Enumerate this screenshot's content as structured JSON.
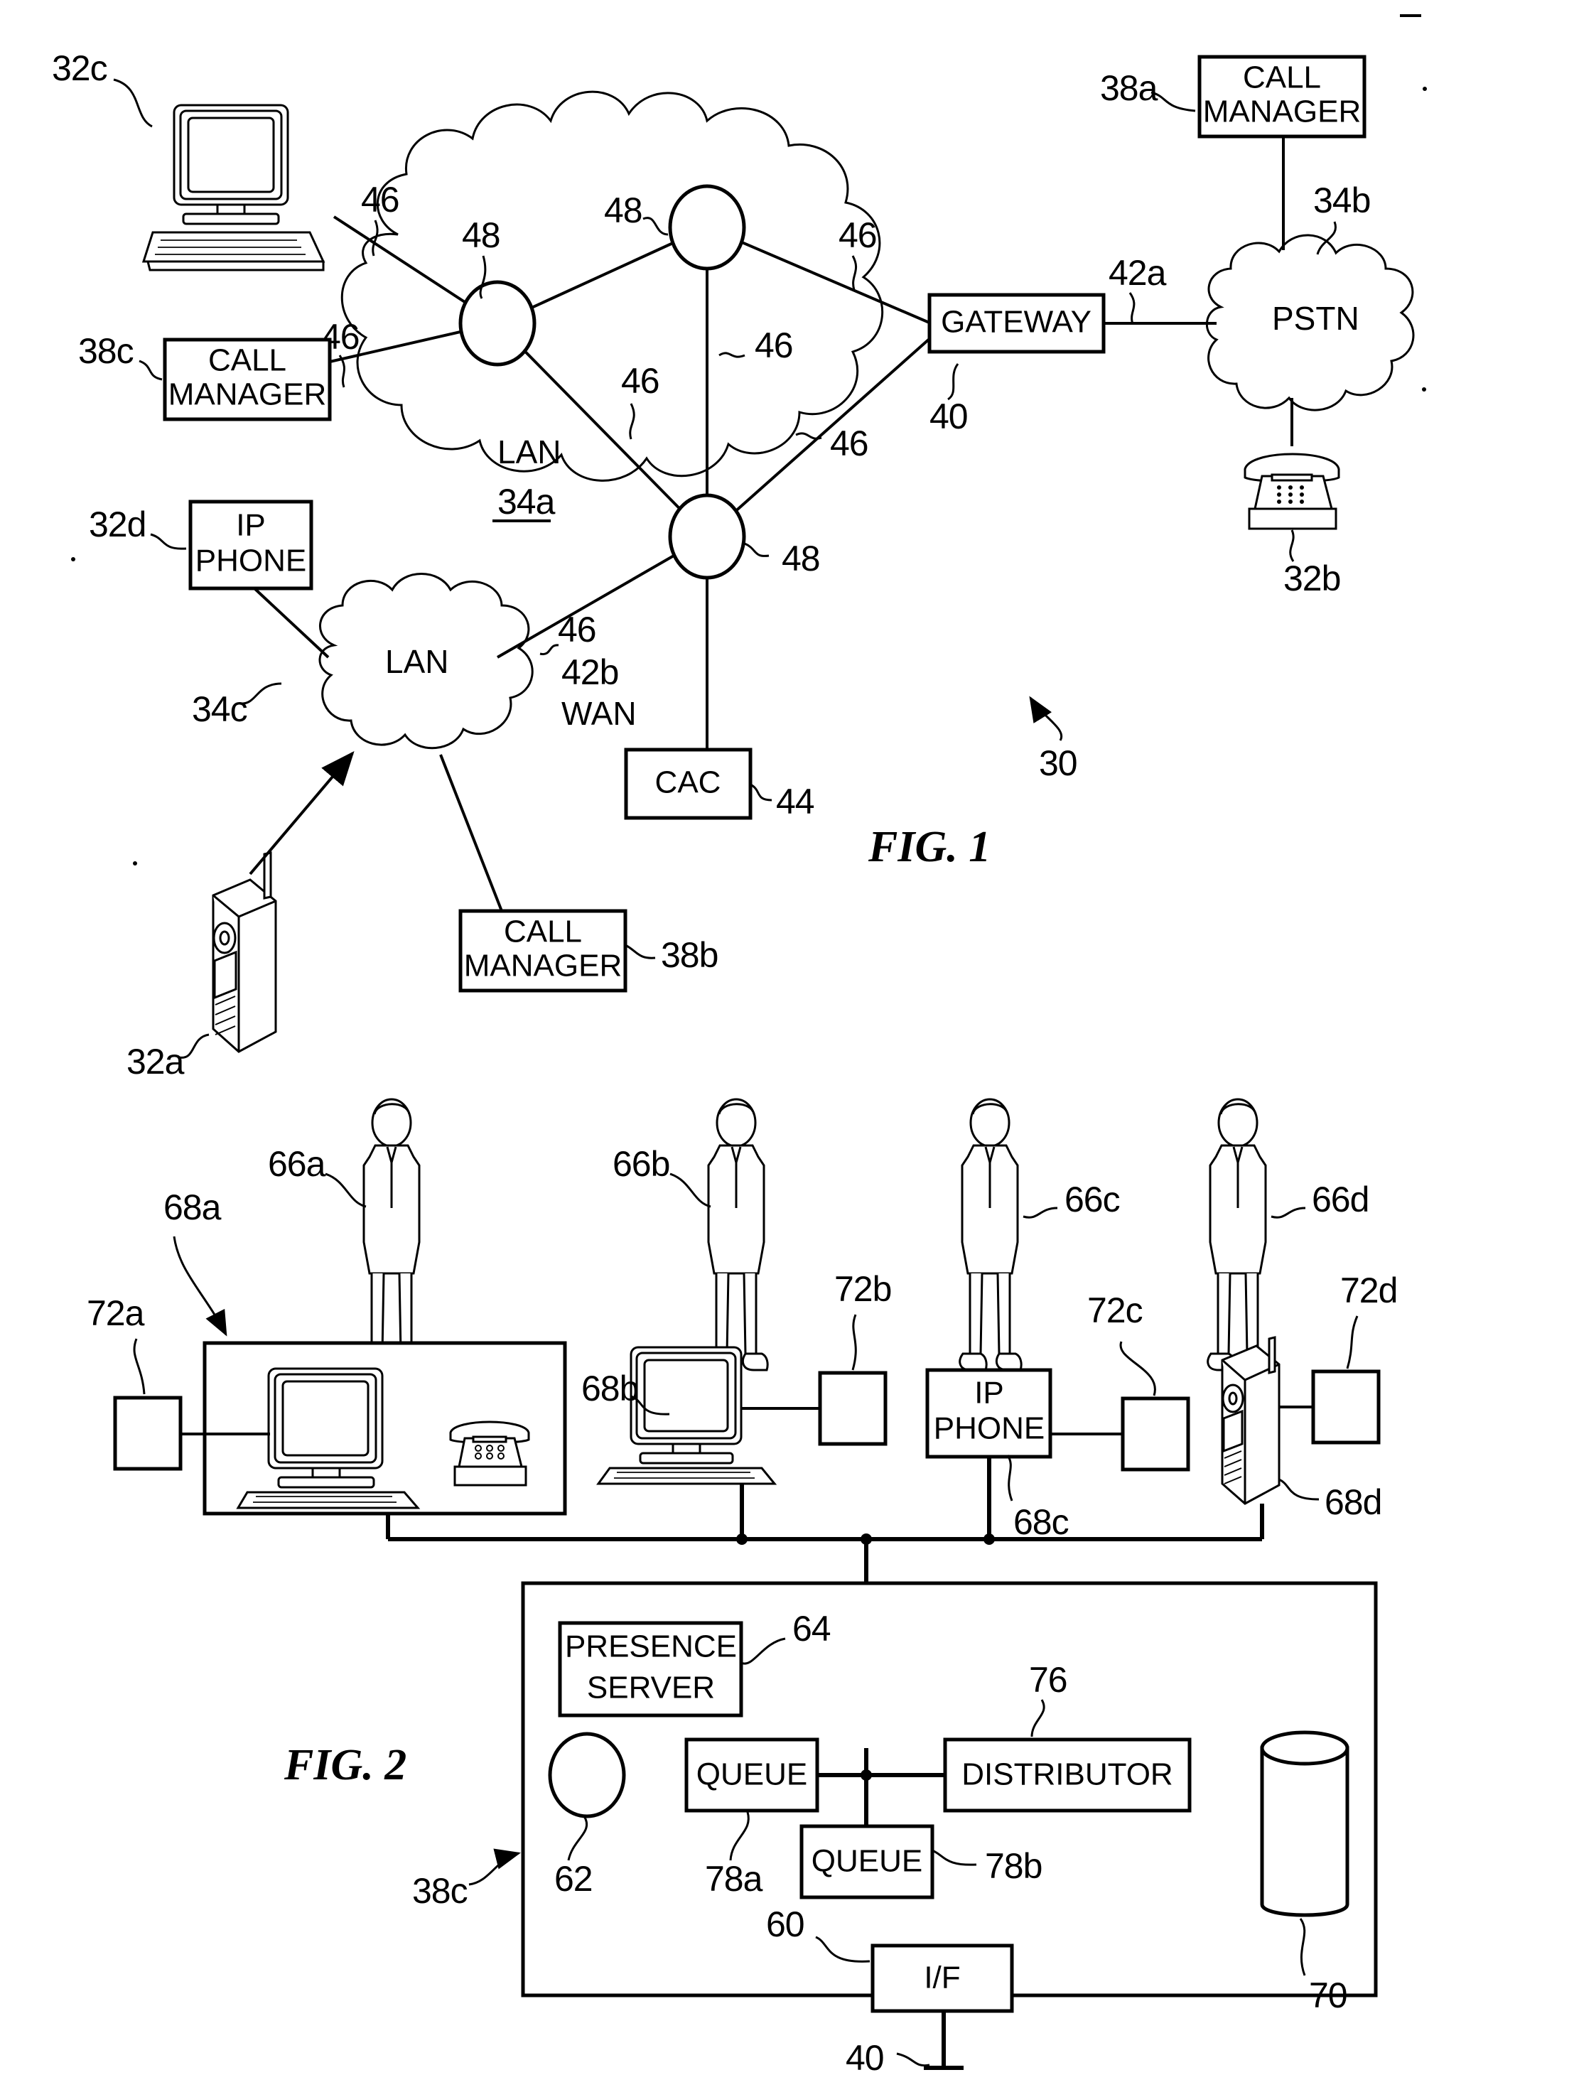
{
  "figures": [
    {
      "id": "fig1",
      "caption": "FIG. 1",
      "system_ref": "30",
      "nodes": {
        "computer_32c_ref": "32c",
        "call_manager_38c_label": "CALL\nMANAGER",
        "call_manager_38c_ref": "38c",
        "ip_phone_32d_label": "IP\nPHONE",
        "ip_phone_32d_ref": "32d",
        "lan_34a_label": "LAN",
        "lan_34a_ref": "34a",
        "lan_34c_label": "LAN",
        "lan_34c_ref": "34c",
        "wan_42b_ref": "42b",
        "wan_42b_label": "WAN",
        "cac_label": "CAC",
        "cac_ref": "44",
        "gateway_label": "GATEWAY",
        "gateway_ref": "40",
        "pstn_label": "PSTN",
        "pstn_ref": "34b",
        "link_42a_ref": "42a",
        "call_manager_38a_label": "CALL\nMANAGER",
        "call_manager_38a_ref": "38a",
        "telephone_32b_ref": "32b",
        "mobile_32a_ref": "32a",
        "call_manager_38b_label": "CALL\nMANAGER",
        "call_manager_38b_ref": "38b"
      },
      "link_refs": [
        "46",
        "46",
        "46",
        "46",
        "46",
        "46",
        "46"
      ],
      "router_refs": [
        "48",
        "48",
        "48"
      ]
    },
    {
      "id": "fig2",
      "caption": "FIG. 2",
      "persons": [
        {
          "ref": "66a"
        },
        {
          "ref": "66b"
        },
        {
          "ref": "66c"
        },
        {
          "ref": "66d"
        }
      ],
      "endpoints": [
        {
          "ref": "68a",
          "type": "computer-and-telephone-group"
        },
        {
          "ref": "68b",
          "type": "computer"
        },
        {
          "ref": "68c",
          "type": "ip-phone",
          "label": "IP\nPHONE"
        },
        {
          "ref": "68d",
          "type": "mobile-phone"
        }
      ],
      "status_boxes": [
        {
          "ref": "72a"
        },
        {
          "ref": "72b"
        },
        {
          "ref": "72c"
        },
        {
          "ref": "72d"
        }
      ],
      "server": {
        "ref": "38c",
        "presence_server_label": "PRESENCE\nSERVER",
        "presence_server_ref": "64",
        "processor_ref": "62",
        "queue_a_label": "QUEUE",
        "queue_a_ref": "78a",
        "queue_b_label": "QUEUE",
        "queue_b_ref": "78b",
        "distributor_label": "DISTRIBUTOR",
        "distributor_ref": "76",
        "database_ref": "70",
        "interface_label": "I/F",
        "interface_ref": "60",
        "network_ref": "40"
      }
    }
  ],
  "text": {
    "fig1_caption": "FIG. 1",
    "fig2_caption": "FIG. 2",
    "call_manager": "CALL",
    "call_manager2": "MANAGER",
    "ip": "IP",
    "phone": "PHONE",
    "lan": "LAN",
    "wan": "WAN",
    "cac": "CAC",
    "gateway": "GATEWAY",
    "pstn": "PSTN",
    "presence": "PRESENCE",
    "server": "SERVER",
    "queue": "QUEUE",
    "distributor": "DISTRIBUTOR",
    "iface": "I/F",
    "r30": "30",
    "r32a": "32a",
    "r32b": "32b",
    "r32c": "32c",
    "r32d": "32d",
    "r34a": "34a",
    "r34b": "34b",
    "r34c": "34c",
    "r38a": "38a",
    "r38b": "38b",
    "r38c": "38c",
    "r38c2": "38c",
    "r40": "40",
    "r40b": "40",
    "r42a": "42a",
    "r42b": "42b",
    "r44": "44",
    "r46_1": "46",
    "r46_2": "46",
    "r46_3": "46",
    "r46_4": "46",
    "r46_5": "46",
    "r46_6": "46",
    "r46_7": "46",
    "r48_1": "48",
    "r48_2": "48",
    "r48_3": "48",
    "r60": "60",
    "r62": "62",
    "r64": "64",
    "r66a": "66a",
    "r66b": "66b",
    "r66c": "66c",
    "r66d": "66d",
    "r68a": "68a",
    "r68b": "68b",
    "r68c": "68c",
    "r68d": "68d",
    "r70": "70",
    "r72a": "72a",
    "r72b": "72b",
    "r72c": "72c",
    "r72d": "72d",
    "r76": "76",
    "r78a": "78a",
    "r78b": "78b"
  }
}
